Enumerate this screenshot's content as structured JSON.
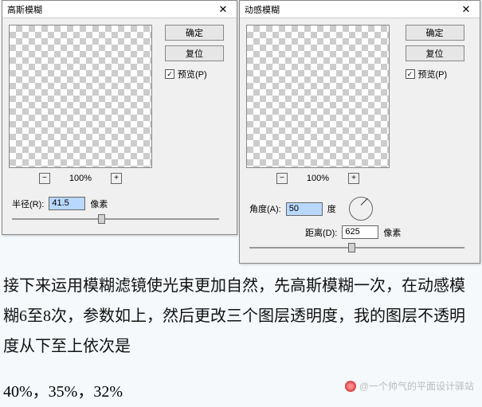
{
  "dialog1": {
    "title": "高斯模糊",
    "zoom": "100%",
    "ok": "确定",
    "reset": "复位",
    "preview": "预览(P)",
    "radius_label": "半径(R):",
    "radius_value": "41.5",
    "radius_unit": "像素"
  },
  "dialog2": {
    "title": "动感模糊",
    "zoom": "100%",
    "ok": "确定",
    "reset": "复位",
    "preview": "预览(P)",
    "angle_label": "角度(A):",
    "angle_value": "50",
    "angle_unit": "度",
    "distance_label": "距离(D):",
    "distance_value": "625",
    "distance_unit": "像素"
  },
  "caption": {
    "text": "接下来运用模糊滤镜使光束更加自然，先高斯模糊一次，在动感模糊6至8次，参数如上，然后更改三个图层透明度，我的图层不透明度从下至上依次是",
    "percentages": "40%，35%，32%"
  },
  "watermark": "@一个帅气的平面设计驿站",
  "icons": {
    "close": "✕",
    "minus": "−",
    "plus": "+",
    "check": "✓"
  }
}
